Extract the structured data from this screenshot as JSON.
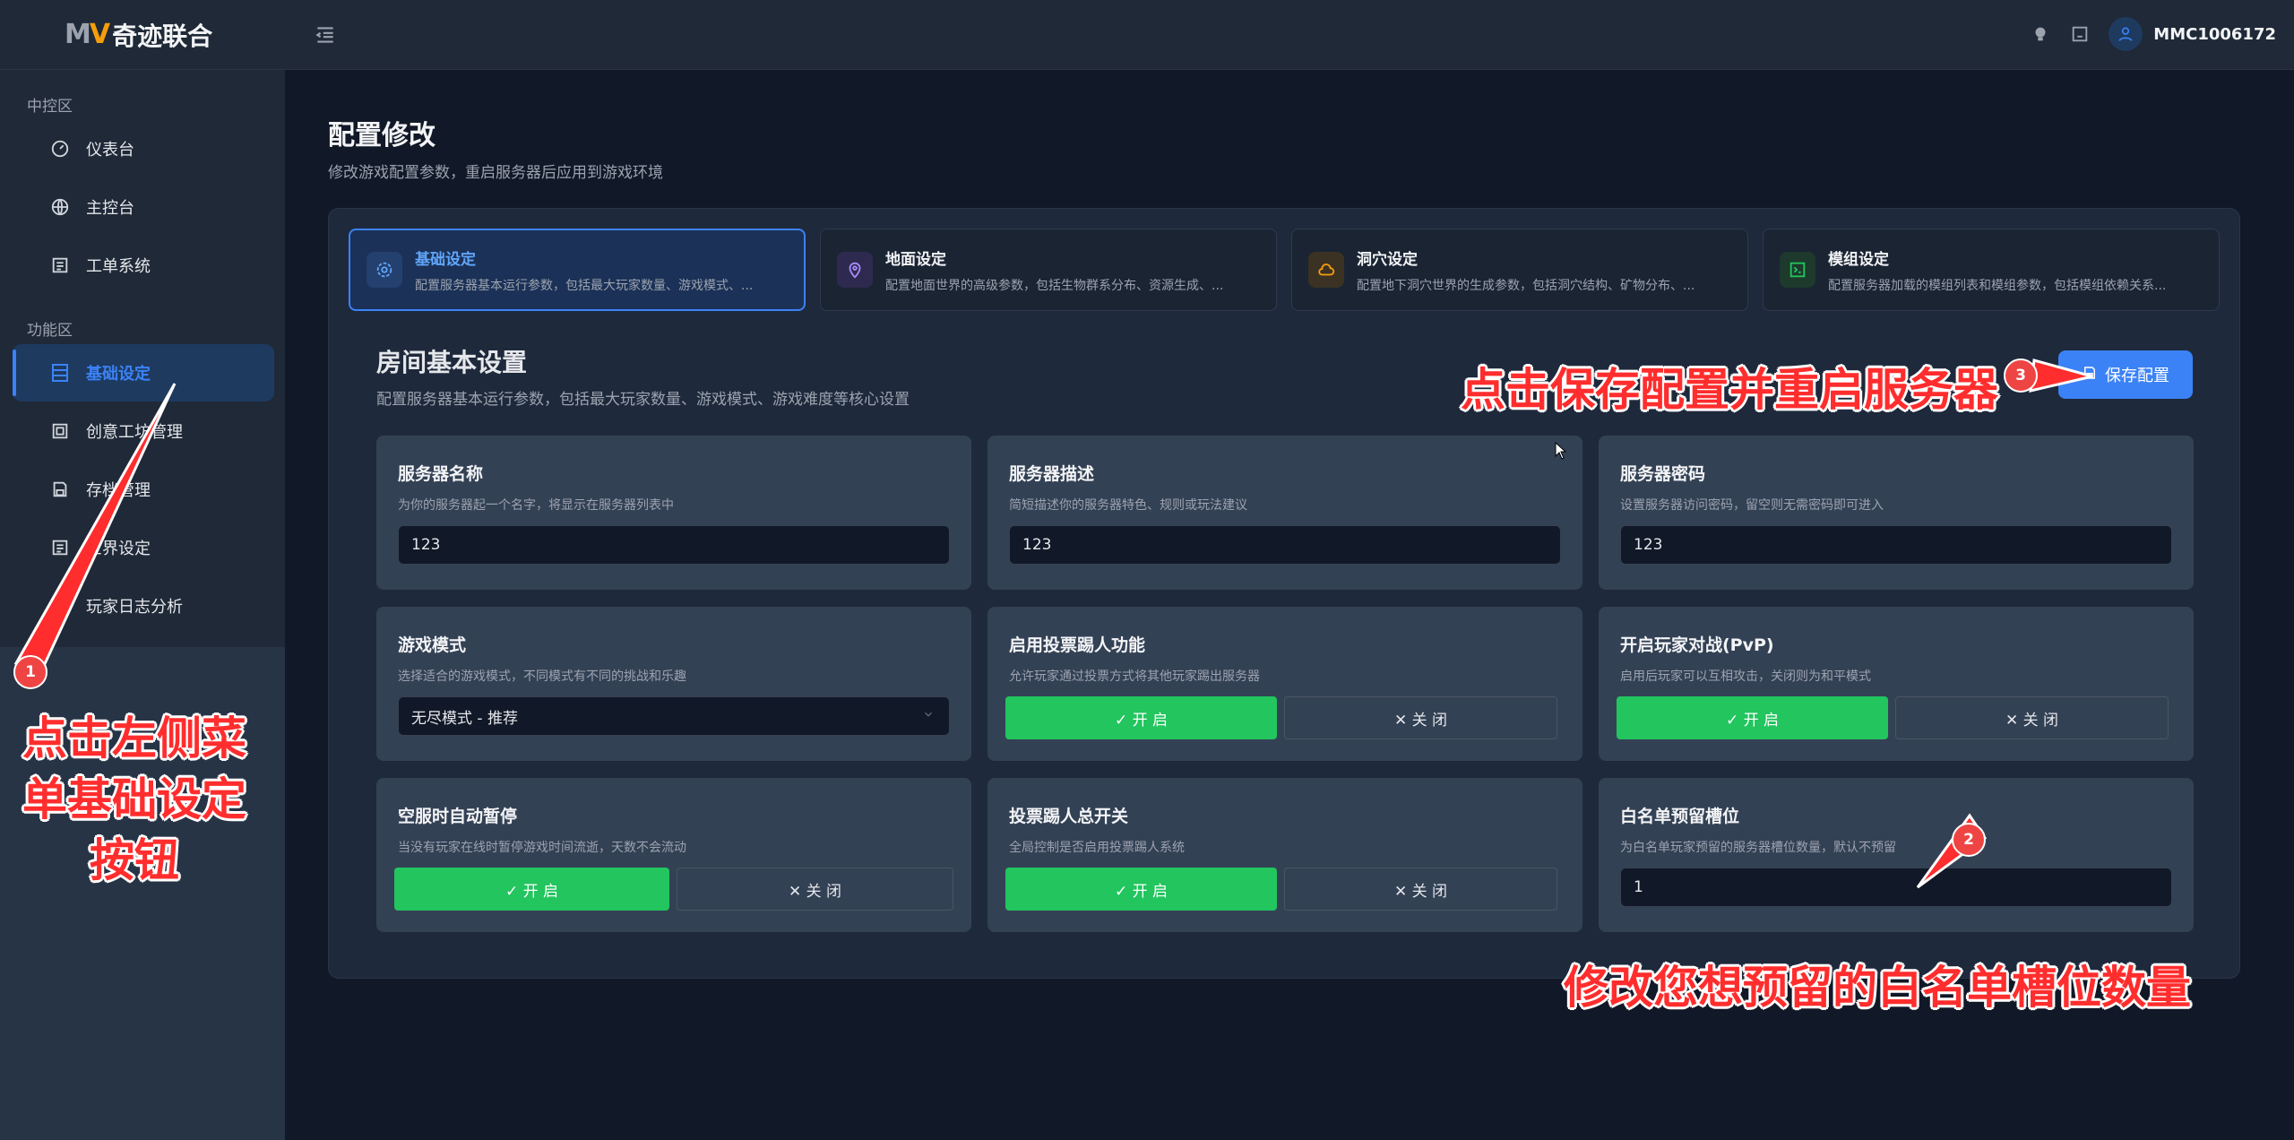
{
  "brand": {
    "mark_m": "M",
    "mark_v": "V",
    "name": "奇迹联合"
  },
  "sidebar": {
    "section1": "中控区",
    "section2": "功能区",
    "items": [
      {
        "label": "仪表台",
        "icon": "gauge-icon"
      },
      {
        "label": "主控台",
        "icon": "globe-icon"
      },
      {
        "label": "工单系统",
        "icon": "list-icon"
      },
      {
        "label": "基础设定",
        "icon": "settings-sheet-icon"
      },
      {
        "label": "创意工坊管理",
        "icon": "workshop-icon"
      },
      {
        "label": "存档管理",
        "icon": "save-icon"
      },
      {
        "label": "世界设定",
        "icon": "list-icon"
      },
      {
        "label": "玩家日志分析",
        "icon": "log-icon"
      }
    ]
  },
  "topbar": {
    "username": "MMC1006172"
  },
  "page": {
    "title": "配置修改",
    "subtitle": "修改游戏配置参数，重启服务器后应用到游戏环境"
  },
  "tabs": [
    {
      "title": "基础设定",
      "desc": "配置服务器基本运行参数，包括最大玩家数量、游戏模式、...",
      "icon": "gear-icon",
      "color": "#3b82f6"
    },
    {
      "title": "地面设定",
      "desc": "配置地面世界的高级参数，包括生物群系分布、资源生成、...",
      "icon": "map-pin-icon",
      "color": "#8b5cf6"
    },
    {
      "title": "洞穴设定",
      "desc": "配置地下洞穴世界的生成参数，包括洞穴结构、矿物分布、...",
      "icon": "cloud-icon",
      "color": "#f59e0b"
    },
    {
      "title": "模组设定",
      "desc": "配置服务器加载的模组列表和模组参数，包括模组依赖关系...",
      "icon": "terminal-icon",
      "color": "#22c55e"
    }
  ],
  "section": {
    "title": "房间基本设置",
    "subtitle": "配置服务器基本运行参数，包括最大玩家数量、游戏模式、游戏难度等核心设置",
    "save_label": "保存配置"
  },
  "cards": {
    "server_name": {
      "title": "服务器名称",
      "desc": "为你的服务器起一个名字，将显示在服务器列表中",
      "value": "123"
    },
    "server_desc": {
      "title": "服务器描述",
      "desc": "简短描述你的服务器特色、规则或玩法建议",
      "value": "123"
    },
    "server_pwd": {
      "title": "服务器密码",
      "desc": "设置服务器访问密码，留空则无需密码即可进入",
      "value": "123"
    },
    "game_mode": {
      "title": "游戏模式",
      "desc": "选择适合的游戏模式，不同模式有不同的挑战和乐趣",
      "value": "无尽模式 - 推荐"
    },
    "vote_kick": {
      "title": "启用投票踢人功能",
      "desc": "允许玩家通过投票方式将其他玩家踢出服务器"
    },
    "pvp": {
      "title": "开启玩家对战(PvP)",
      "desc": "启用后玩家可以互相攻击，关闭则为和平模式"
    },
    "pause_empty": {
      "title": "空服时自动暂停",
      "desc": "当没有玩家在线时暂停游戏时间流逝，天数不会流动"
    },
    "vote_master": {
      "title": "投票踢人总开关",
      "desc": "全局控制是否启用投票踢人系统"
    },
    "whitelist": {
      "title": "白名单预留槽位",
      "desc": "为白名单玩家预留的服务器槽位数量，默认不预留",
      "value": "1"
    }
  },
  "toggle": {
    "on": "✓ 开 启",
    "off": "✕ 关 闭"
  },
  "annotations": {
    "a1": "点击左侧菜单基础设定按钮",
    "a1_lines": [
      "点击左侧菜",
      "单基础设定",
      "按钮"
    ],
    "a2": "修改您想预留的白名单槽位数量",
    "a3": "点击保存配置并重启服务器",
    "badge1": "1",
    "badge2": "2",
    "badge3": "3"
  },
  "colors": {
    "accent": "#3b82f6",
    "on": "#22c55e",
    "annotation": "#ff2d2d"
  }
}
